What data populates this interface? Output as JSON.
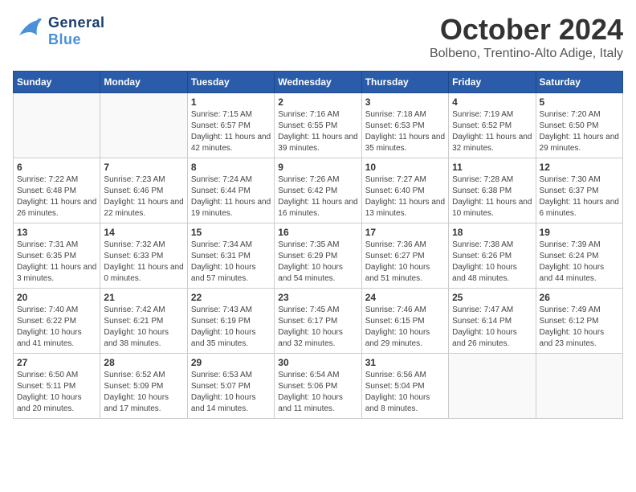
{
  "header": {
    "logo_general": "General",
    "logo_blue": "Blue",
    "month": "October 2024",
    "location": "Bolbeno, Trentino-Alto Adige, Italy"
  },
  "weekdays": [
    "Sunday",
    "Monday",
    "Tuesday",
    "Wednesday",
    "Thursday",
    "Friday",
    "Saturday"
  ],
  "weeks": [
    [
      {
        "day": "",
        "info": ""
      },
      {
        "day": "",
        "info": ""
      },
      {
        "day": "1",
        "info": "Sunrise: 7:15 AM\nSunset: 6:57 PM\nDaylight: 11 hours and 42 minutes."
      },
      {
        "day": "2",
        "info": "Sunrise: 7:16 AM\nSunset: 6:55 PM\nDaylight: 11 hours and 39 minutes."
      },
      {
        "day": "3",
        "info": "Sunrise: 7:18 AM\nSunset: 6:53 PM\nDaylight: 11 hours and 35 minutes."
      },
      {
        "day": "4",
        "info": "Sunrise: 7:19 AM\nSunset: 6:52 PM\nDaylight: 11 hours and 32 minutes."
      },
      {
        "day": "5",
        "info": "Sunrise: 7:20 AM\nSunset: 6:50 PM\nDaylight: 11 hours and 29 minutes."
      }
    ],
    [
      {
        "day": "6",
        "info": "Sunrise: 7:22 AM\nSunset: 6:48 PM\nDaylight: 11 hours and 26 minutes."
      },
      {
        "day": "7",
        "info": "Sunrise: 7:23 AM\nSunset: 6:46 PM\nDaylight: 11 hours and 22 minutes."
      },
      {
        "day": "8",
        "info": "Sunrise: 7:24 AM\nSunset: 6:44 PM\nDaylight: 11 hours and 19 minutes."
      },
      {
        "day": "9",
        "info": "Sunrise: 7:26 AM\nSunset: 6:42 PM\nDaylight: 11 hours and 16 minutes."
      },
      {
        "day": "10",
        "info": "Sunrise: 7:27 AM\nSunset: 6:40 PM\nDaylight: 11 hours and 13 minutes."
      },
      {
        "day": "11",
        "info": "Sunrise: 7:28 AM\nSunset: 6:38 PM\nDaylight: 11 hours and 10 minutes."
      },
      {
        "day": "12",
        "info": "Sunrise: 7:30 AM\nSunset: 6:37 PM\nDaylight: 11 hours and 6 minutes."
      }
    ],
    [
      {
        "day": "13",
        "info": "Sunrise: 7:31 AM\nSunset: 6:35 PM\nDaylight: 11 hours and 3 minutes."
      },
      {
        "day": "14",
        "info": "Sunrise: 7:32 AM\nSunset: 6:33 PM\nDaylight: 11 hours and 0 minutes."
      },
      {
        "day": "15",
        "info": "Sunrise: 7:34 AM\nSunset: 6:31 PM\nDaylight: 10 hours and 57 minutes."
      },
      {
        "day": "16",
        "info": "Sunrise: 7:35 AM\nSunset: 6:29 PM\nDaylight: 10 hours and 54 minutes."
      },
      {
        "day": "17",
        "info": "Sunrise: 7:36 AM\nSunset: 6:27 PM\nDaylight: 10 hours and 51 minutes."
      },
      {
        "day": "18",
        "info": "Sunrise: 7:38 AM\nSunset: 6:26 PM\nDaylight: 10 hours and 48 minutes."
      },
      {
        "day": "19",
        "info": "Sunrise: 7:39 AM\nSunset: 6:24 PM\nDaylight: 10 hours and 44 minutes."
      }
    ],
    [
      {
        "day": "20",
        "info": "Sunrise: 7:40 AM\nSunset: 6:22 PM\nDaylight: 10 hours and 41 minutes."
      },
      {
        "day": "21",
        "info": "Sunrise: 7:42 AM\nSunset: 6:21 PM\nDaylight: 10 hours and 38 minutes."
      },
      {
        "day": "22",
        "info": "Sunrise: 7:43 AM\nSunset: 6:19 PM\nDaylight: 10 hours and 35 minutes."
      },
      {
        "day": "23",
        "info": "Sunrise: 7:45 AM\nSunset: 6:17 PM\nDaylight: 10 hours and 32 minutes."
      },
      {
        "day": "24",
        "info": "Sunrise: 7:46 AM\nSunset: 6:15 PM\nDaylight: 10 hours and 29 minutes."
      },
      {
        "day": "25",
        "info": "Sunrise: 7:47 AM\nSunset: 6:14 PM\nDaylight: 10 hours and 26 minutes."
      },
      {
        "day": "26",
        "info": "Sunrise: 7:49 AM\nSunset: 6:12 PM\nDaylight: 10 hours and 23 minutes."
      }
    ],
    [
      {
        "day": "27",
        "info": "Sunrise: 6:50 AM\nSunset: 5:11 PM\nDaylight: 10 hours and 20 minutes."
      },
      {
        "day": "28",
        "info": "Sunrise: 6:52 AM\nSunset: 5:09 PM\nDaylight: 10 hours and 17 minutes."
      },
      {
        "day": "29",
        "info": "Sunrise: 6:53 AM\nSunset: 5:07 PM\nDaylight: 10 hours and 14 minutes."
      },
      {
        "day": "30",
        "info": "Sunrise: 6:54 AM\nSunset: 5:06 PM\nDaylight: 10 hours and 11 minutes."
      },
      {
        "day": "31",
        "info": "Sunrise: 6:56 AM\nSunset: 5:04 PM\nDaylight: 10 hours and 8 minutes."
      },
      {
        "day": "",
        "info": ""
      },
      {
        "day": "",
        "info": ""
      }
    ]
  ]
}
